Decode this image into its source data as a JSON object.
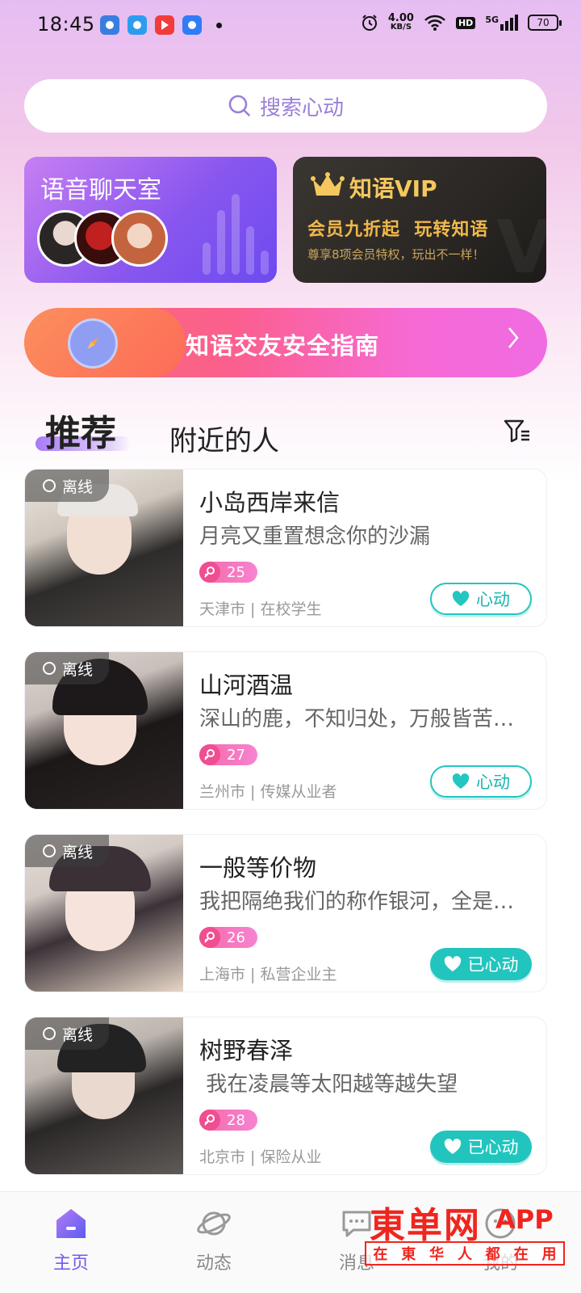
{
  "status_bar": {
    "time": "18:45",
    "net_speed_value": "4.00",
    "net_speed_unit": "KB/S",
    "hd": "HD",
    "signal": "5G",
    "battery": "70"
  },
  "search": {
    "placeholder": "搜索心动"
  },
  "voice_room": {
    "title": "语音聊天室"
  },
  "vip": {
    "title": "知语VIP",
    "line": "会员九折起  玩转知语",
    "sub": "尊享8项会员特权，玩出不一样！"
  },
  "safety": {
    "label": "知语交友安全指南"
  },
  "tabs": {
    "recommend": "推荐",
    "nearby": "附近的人"
  },
  "users": [
    {
      "status": "离线",
      "name": "小岛西岸来信",
      "bio": "月亮又重置想念你的沙漏",
      "age": "25",
      "meta": "天津市 | 在校学生",
      "like": "心动",
      "liked": false
    },
    {
      "status": "离线",
      "name": "山河酒温",
      "bio": "深山的鹿，不知归处，万般皆苦…",
      "age": "27",
      "meta": "兰州市 | 传媒从业者",
      "like": "心动",
      "liked": false
    },
    {
      "status": "离线",
      "name": "一般等价物",
      "bio": "我把隔绝我们的称作银河，全是…",
      "age": "26",
      "meta": "上海市 | 私营企业主",
      "like": "已心动",
      "liked": true
    },
    {
      "status": "离线",
      "name": "树野春泽",
      "bio": " 我在凌晨等太阳越等越失望",
      "age": "28",
      "meta": "北京市 | 保险从业",
      "like": "已心动",
      "liked": true
    }
  ],
  "nav": {
    "home": "主页",
    "moments": "动态",
    "messages": "消息",
    "mine": "我的"
  },
  "watermark": {
    "brand": "東单网",
    "app": "APP",
    "chars": [
      "在",
      "東",
      "华",
      "人",
      "都",
      "在",
      "用"
    ]
  },
  "colors": {
    "accent": "#6e5cf0",
    "teal": "#22c5be",
    "pink": "#f46aa7"
  }
}
